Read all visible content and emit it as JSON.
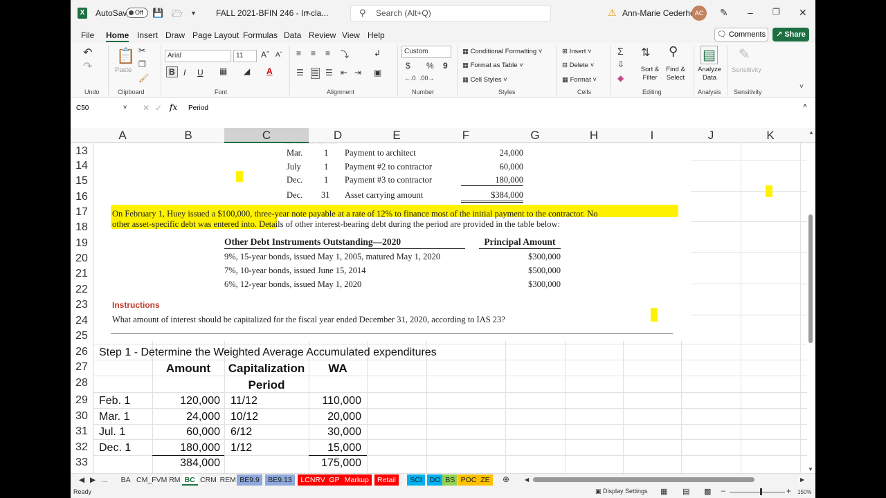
{
  "titlebar": {
    "excel_logo": "X",
    "autosave_label": "AutoSave",
    "autosave_state": "Off",
    "doc_title": "FALL 2021-BFIN 246 - In-cla...",
    "search_placeholder": "Search (Alt+Q)",
    "user_name": "Ann-Marie Cederholm",
    "user_initials": "AC"
  },
  "menu": {
    "items": [
      "File",
      "Home",
      "Insert",
      "Draw",
      "Page Layout",
      "Formulas",
      "Data",
      "Review",
      "View",
      "Help"
    ],
    "active": "Home",
    "comments_label": "Comments",
    "share_label": "Share"
  },
  "ribbon": {
    "font_name": "Arial",
    "font_size": "11",
    "number_format": "Custom",
    "paste_label": "Paste",
    "bold_label": "B",
    "italic_label": "I",
    "underline_label": "U",
    "currency_symbol": "$",
    "percent_symbol": "%",
    "comma_symbol": "9",
    "conditional_formatting": "Conditional Formatting",
    "format_as_table": "Format as Table",
    "cell_styles": "Cell Styles",
    "insert": "Insert",
    "delete": "Delete",
    "format": "Format",
    "sort_filter": "Sort & Filter",
    "find_select": "Find & Select",
    "analyze_data": "Analyze Data",
    "sensitivity": "Sensitivity",
    "groups": [
      "Undo",
      "Clipboard",
      "Font",
      "Alignment",
      "Number",
      "Styles",
      "Cells",
      "Editing",
      "Analysis",
      "Sensitivity"
    ]
  },
  "formula_bar": {
    "cell_ref": "C50",
    "fx_label": "fx",
    "content": "Period"
  },
  "columns": [
    "A",
    "B",
    "C",
    "D",
    "E",
    "F",
    "G",
    "H",
    "I",
    "J",
    "K"
  ],
  "rows": [
    "13",
    "14",
    "15",
    "16",
    "17",
    "18",
    "19",
    "20",
    "21",
    "22",
    "23",
    "24",
    "25",
    "26",
    "27",
    "28",
    "29",
    "30",
    "31",
    "32",
    "33"
  ],
  "problem": {
    "payments": [
      {
        "month": "Mar.",
        "day": "1",
        "desc": "Payment to architect",
        "amount": "24,000"
      },
      {
        "month": "July",
        "day": "1",
        "desc": "Payment #2 to contractor",
        "amount": "60,000"
      },
      {
        "month": "Dec.",
        "day": "1",
        "desc": "Payment #3 to contractor",
        "amount": "180,000"
      },
      {
        "month": "Dec.",
        "day": "31",
        "desc": "Asset carrying amount",
        "amount": "$384,000"
      }
    ],
    "paragraph_line1": "On February 1, Huey issued a $100,000, three-year note payable at a rate of 12% to finance most of the initial payment to the contractor. No",
    "paragraph_line2": "other asset-specific debt was entered into. Details of other interest-bearing debt during the period are provided in the table below:",
    "debt_header_left": "Other Debt Instruments Outstanding—2020",
    "debt_header_right": "Principal Amount",
    "debts": [
      {
        "desc": "9%, 15-year bonds, issued May 1, 2005, matured May 1, 2020",
        "amount": "$300,000"
      },
      {
        "desc": "7%, 10-year bonds, issued June 15, 2014",
        "amount": "$500,000"
      },
      {
        "desc": "6%, 12-year bonds, issued May 1, 2020",
        "amount": "$300,000"
      }
    ],
    "instructions_label": "Instructions",
    "question": "What amount of interest should be capitalized for the fiscal year ended December 31, 2020, according to IAS 23?"
  },
  "step1": {
    "title": "Step 1 - Determine the Weighted Average Accumulated expenditures",
    "headers": {
      "amount": "Amount",
      "cap_period_line1": "Capitalization",
      "cap_period_line2": "Period",
      "wa": "WA"
    },
    "rows": [
      {
        "date": "Feb. 1",
        "amount": "120,000",
        "period": "11/12",
        "wa": "110,000"
      },
      {
        "date": "Mar. 1",
        "amount": "24,000",
        "period": "10/12",
        "wa": "20,000"
      },
      {
        "date": "Jul. 1",
        "amount": "60,000",
        "period": "6/12",
        "wa": "30,000"
      },
      {
        "date": "Dec. 1",
        "amount": "180,000",
        "period": "1/12",
        "wa": "15,000"
      }
    ],
    "total_amount": "384,000",
    "total_wa": "175,000"
  },
  "sheet_tabs": [
    {
      "name": "...",
      "color": ""
    },
    {
      "name": "BA",
      "color": ""
    },
    {
      "name": "CM_FVM",
      "color": ""
    },
    {
      "name": "RM",
      "color": ""
    },
    {
      "name": "BC",
      "color": "",
      "active": true
    },
    {
      "name": "CRM",
      "color": ""
    },
    {
      "name": "REM",
      "color": ""
    },
    {
      "name": "BE9.9",
      "color": "#8ea9db"
    },
    {
      "name": "BE9.13",
      "color": "#8ea9db"
    },
    {
      "name": "LCNRV",
      "color": "#ff0000"
    },
    {
      "name": "GP",
      "color": "#ff0000"
    },
    {
      "name": "Markup",
      "color": "#ff0000"
    },
    {
      "name": "Retail",
      "color": "#ff0000"
    },
    {
      "name": "SCI",
      "color": "#00b0f0"
    },
    {
      "name": "DO",
      "color": "#00b0f0"
    },
    {
      "name": "BS",
      "color": "#92d050"
    },
    {
      "name": "POC",
      "color": "#ffc000"
    },
    {
      "name": "ZE",
      "color": "#ffc000"
    }
  ],
  "status": {
    "ready": "Ready",
    "display_settings": "Display Settings",
    "zoom": "150%"
  }
}
